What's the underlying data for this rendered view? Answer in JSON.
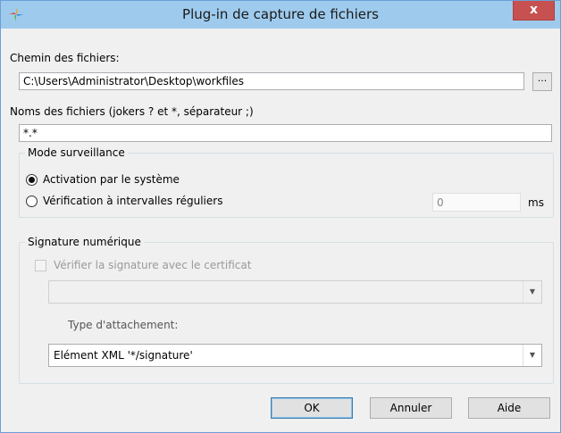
{
  "window": {
    "title": "Plug-in de capture de fichiers",
    "close_label": "x"
  },
  "path": {
    "label": "Chemin des fichiers:",
    "value": "C:\\Users\\Administrator\\Desktop\\workfiles",
    "browse_label": "..."
  },
  "filenames": {
    "label": "Noms des fichiers (jokers ? et *, séparateur ;)",
    "value": "*.*"
  },
  "monitoring": {
    "legend": "Mode surveillance",
    "option_system": "Activation par le système",
    "option_interval": "Vérification à intervalles réguliers",
    "selected": "system",
    "interval_value": "0",
    "interval_unit": "ms"
  },
  "signature": {
    "legend": "Signature numérique",
    "verify_label": "Vérifier la signature avec le certificat",
    "certificate_value": "",
    "attachment_label": "Type d'attachement:",
    "attachment_value": "Elément XML '*/signature'"
  },
  "buttons": {
    "ok": "OK",
    "cancel": "Annuler",
    "help": "Aide"
  },
  "colors": {
    "titlebar": "#9ecbed",
    "close": "#c75050",
    "dialog_bg": "#f0f0f0"
  }
}
